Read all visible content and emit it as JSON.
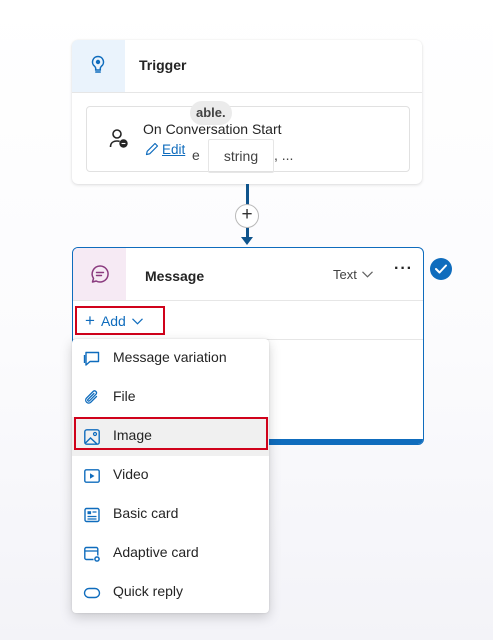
{
  "trigger": {
    "title": "Trigger",
    "event": "On Conversation Start",
    "edit_label": "Edit"
  },
  "connector": {
    "add_symbol": "+"
  },
  "message": {
    "title": "Message",
    "type_label": "Text",
    "more_label": "···",
    "add_label": "Add",
    "variable_chip": "able.",
    "token_partial": "e",
    "token_string": "string",
    "token_ellipsis": ", ..."
  },
  "add_menu": {
    "items": [
      {
        "label": "Message variation",
        "icon": "message-variation-icon"
      },
      {
        "label": "File",
        "icon": "paperclip-icon"
      },
      {
        "label": "Image",
        "icon": "image-icon",
        "selected": true
      },
      {
        "label": "Video",
        "icon": "video-play-icon"
      },
      {
        "label": "Basic card",
        "icon": "basic-card-icon"
      },
      {
        "label": "Adaptive card",
        "icon": "adaptive-card-icon"
      },
      {
        "label": "Quick reply",
        "icon": "quick-reply-icon"
      }
    ]
  },
  "colors": {
    "accent": "#0f6cbd",
    "connector": "#0f548c",
    "highlight": "#d0021b",
    "trigger_icon_bg": "#eaf3fc",
    "message_icon_bg": "#f6eaf4"
  }
}
